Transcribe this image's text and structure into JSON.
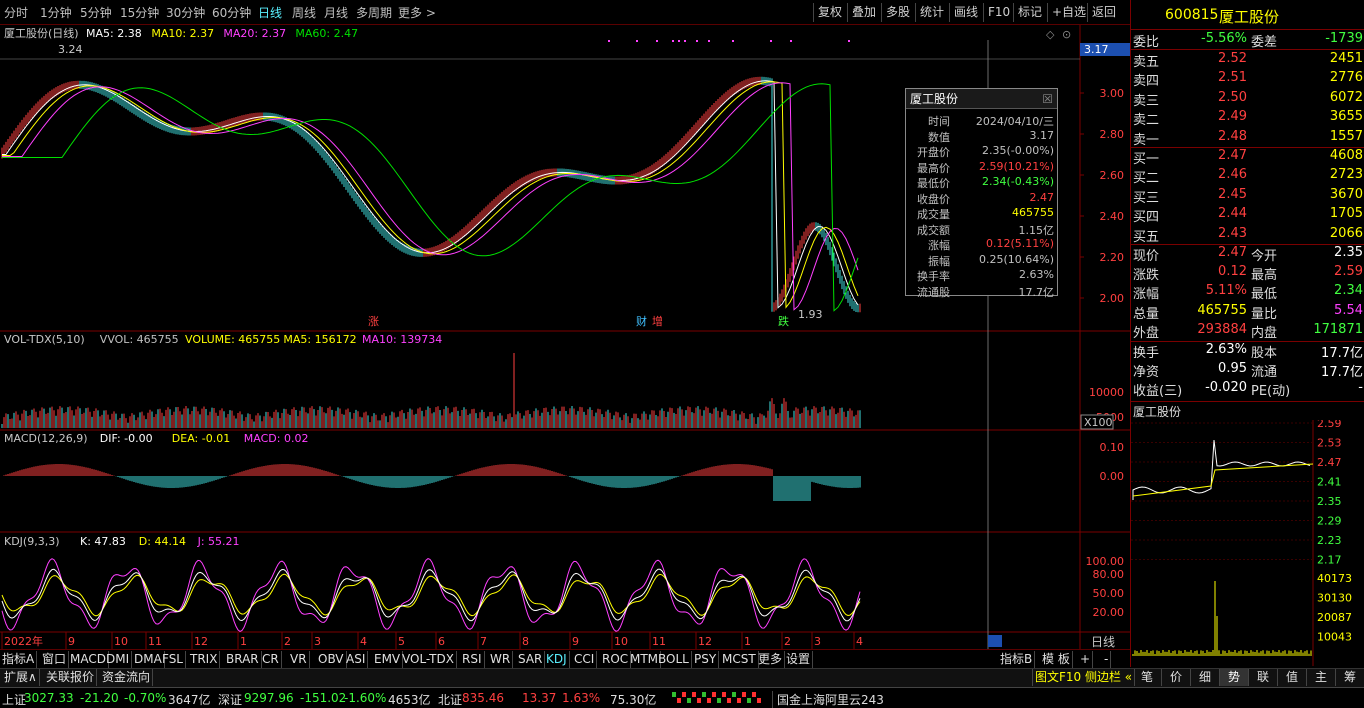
{
  "toolbar": {
    "periods": [
      "分时",
      "1分钟",
      "5分钟",
      "15分钟",
      "30分钟",
      "60分钟",
      "日线",
      "周线",
      "月线",
      "多周期",
      "更多 >"
    ],
    "active": "日线",
    "right": [
      "复权",
      "叠加",
      "多股",
      "统计",
      "画线",
      "F10",
      "标记",
      "+自选",
      "返回"
    ]
  },
  "chart": {
    "title": "厦工股份(日线)",
    "ma": [
      {
        "label": "MA5: 2.38",
        "color": "#ffffff"
      },
      {
        "label": "MA10: 2.37",
        "color": "#ffff00"
      },
      {
        "label": "MA20: 2.37",
        "color": "#ff40ff"
      },
      {
        "label": "MA60: 2.47",
        "color": "#00e000"
      }
    ],
    "high_label": "3.24",
    "low_label": "1.93",
    "cur_price": "3.17",
    "price_ticks": [
      "3.00",
      "2.80",
      "2.60",
      "2.40",
      "2.20",
      "2.00"
    ],
    "markers": [
      {
        "text": "涨",
        "color": "#ff4040"
      },
      {
        "text": "财",
        "color": "#40c0ff"
      },
      {
        "text": "增",
        "color": "#ff4040"
      },
      {
        "text": "跌",
        "color": "#40ff40"
      }
    ]
  },
  "vol": {
    "title": "VOL-TDX(5,10)",
    "items": [
      {
        "label": "VVOL: 465755",
        "color": "#c0c0c0"
      },
      {
        "label": "VOLUME: 465755",
        "color": "#ffff00"
      },
      {
        "label": "MA5: 156172",
        "color": "#ffff00"
      },
      {
        "label": "MA10: 139734",
        "color": "#ff40ff"
      }
    ],
    "ticks": [
      "10000",
      "5000"
    ],
    "unit": "X100"
  },
  "macd": {
    "title": "MACD(12,26,9)",
    "items": [
      {
        "label": "DIF: -0.00",
        "color": "#ffffff"
      },
      {
        "label": "DEA: -0.01",
        "color": "#ffff00"
      },
      {
        "label": "MACD: 0.02",
        "color": "#ff40ff"
      }
    ],
    "ticks": [
      "0.10",
      "0.00"
    ]
  },
  "kdj": {
    "title": "KDJ(9,3,3)",
    "items": [
      {
        "label": "K: 47.83",
        "color": "#ffffff"
      },
      {
        "label": "D: 44.14",
        "color": "#ffff00"
      },
      {
        "label": "J: 55.21",
        "color": "#ff40ff"
      }
    ],
    "ticks": [
      "100.00",
      "80.00",
      "50.00",
      "20.00"
    ]
  },
  "xaxis": {
    "labels": [
      "2022年",
      "9",
      "10",
      "11",
      "12",
      "1",
      "2",
      "3",
      "4",
      "5",
      "6",
      "7",
      "8",
      "9",
      "10",
      "11",
      "12",
      "1",
      "2",
      "3",
      "4"
    ],
    "period_label": "日线"
  },
  "tooltip": {
    "title": "厦工股份",
    "rows": [
      {
        "k": "时间",
        "v": "2024/04/10/三",
        "c": "#c0c0c0"
      },
      {
        "k": "数值",
        "v": "3.17",
        "c": "#c0c0c0"
      },
      {
        "k": "开盘价",
        "v": "2.35(-0.00%)",
        "c": "#c0c0c0"
      },
      {
        "k": "最高价",
        "v": "2.59(10.21%)",
        "c": "#ff4040"
      },
      {
        "k": "最低价",
        "v": "2.34(-0.43%)",
        "c": "#40ff40"
      },
      {
        "k": "收盘价",
        "v": "2.47",
        "c": "#ff4040"
      },
      {
        "k": "成交量",
        "v": "465755",
        "c": "#ffff00"
      },
      {
        "k": "成交额",
        "v": "1.15亿",
        "c": "#c0c0c0"
      },
      {
        "k": "涨幅",
        "v": "0.12(5.11%)",
        "c": "#ff4040"
      },
      {
        "k": "振幅",
        "v": "0.25(10.64%)",
        "c": "#c0c0c0"
      },
      {
        "k": "换手率",
        "v": "2.63%",
        "c": "#c0c0c0"
      },
      {
        "k": "流通股",
        "v": "17.7亿",
        "c": "#c0c0c0"
      }
    ]
  },
  "quote": {
    "code": "600815",
    "name": "厦工股份",
    "webi": {
      "k": "委比",
      "v": "-5.56%",
      "k2": "委差",
      "v2": "-1739"
    },
    "sell": [
      {
        "k": "卖五",
        "p": "2.52",
        "v": "2451"
      },
      {
        "k": "卖四",
        "p": "2.51",
        "v": "2776"
      },
      {
        "k": "卖三",
        "p": "2.50",
        "v": "6072"
      },
      {
        "k": "卖二",
        "p": "2.49",
        "v": "3655"
      },
      {
        "k": "卖一",
        "p": "2.48",
        "v": "1557"
      }
    ],
    "buy": [
      {
        "k": "买一",
        "p": "2.47",
        "v": "4608"
      },
      {
        "k": "买二",
        "p": "2.46",
        "v": "2723"
      },
      {
        "k": "买三",
        "p": "2.45",
        "v": "3670"
      },
      {
        "k": "买四",
        "p": "2.44",
        "v": "1705"
      },
      {
        "k": "买五",
        "p": "2.43",
        "v": "2066"
      }
    ],
    "stats": [
      {
        "k": "现价",
        "v": "2.47",
        "c": "#ff4040",
        "k2": "今开",
        "v2": "2.35",
        "c2": "#ffffff"
      },
      {
        "k": "涨跌",
        "v": "0.12",
        "c": "#ff4040",
        "k2": "最高",
        "v2": "2.59",
        "c2": "#ff4040"
      },
      {
        "k": "涨幅",
        "v": "5.11%",
        "c": "#ff4040",
        "k2": "最低",
        "v2": "2.34",
        "c2": "#40ff40"
      },
      {
        "k": "总量",
        "v": "465755",
        "c": "#ffff00",
        "k2": "量比",
        "v2": "5.54",
        "c2": "#ff40ff"
      },
      {
        "k": "外盘",
        "v": "293884",
        "c": "#ff4040",
        "k2": "内盘",
        "v2": "171871",
        "c2": "#40ff40"
      }
    ],
    "stats2": [
      {
        "k": "换手",
        "v": "2.63%",
        "k2": "股本",
        "v2": "17.7亿"
      },
      {
        "k": "净资",
        "v": "0.95",
        "k2": "流通",
        "v2": "17.7亿"
      },
      {
        "k": "收益(三)",
        "v": "-0.020",
        "k2": "PE(动)",
        "v2": "-"
      }
    ]
  },
  "mini": {
    "title": "厦工股份",
    "ticks": [
      {
        "v": "2.59",
        "c": "#ff4040"
      },
      {
        "v": "2.53",
        "c": "#ff4040"
      },
      {
        "v": "2.47",
        "c": "#ff4040"
      },
      {
        "v": "2.41",
        "c": "#40ff40"
      },
      {
        "v": "2.35",
        "c": "#40ff40"
      },
      {
        "v": "2.29",
        "c": "#40ff40"
      },
      {
        "v": "2.23",
        "c": "#40ff40"
      },
      {
        "v": "2.17",
        "c": "#40ff40"
      }
    ],
    "vticks": [
      "40173",
      "30130",
      "20087",
      "10043"
    ],
    "tabs": [
      "笔",
      "价",
      "细",
      "势",
      "联",
      "值",
      "主",
      "筹"
    ],
    "active_tab": "势"
  },
  "indicators": [
    "指标A",
    "窗口",
    "MACD",
    "DMI",
    "DMA",
    "FSL",
    "TRIX",
    "BRAR",
    "CR",
    "VR",
    "OBV",
    "ASI",
    "EMV",
    "VOL-TDX",
    "RSI",
    "WR",
    "SAR",
    "KDJ",
    "CCI",
    "ROC",
    "MTM",
    "BOLL",
    "PSY",
    "MCST",
    "更多",
    "设置"
  ],
  "ind_right": [
    "指标B",
    "模 板",
    "+",
    "-"
  ],
  "bottom_tabs": [
    "扩展∧",
    "关联报价",
    "资金流向"
  ],
  "sidebar_btn": "图文F10 侧边栏 «",
  "status": [
    {
      "name": "上证",
      "v": "3027.33",
      "ch": "-21.20",
      "pc": "-0.70%",
      "amt": "3647亿",
      "c": "#40ff40"
    },
    {
      "name": "深证",
      "v": "9297.96",
      "ch": "-151.02",
      "pc": "-1.60%",
      "amt": "4653亿",
      "c": "#40ff40"
    },
    {
      "name": "北证",
      "v": "835.46",
      "ch": "13.37",
      "pc": "1.63%",
      "amt": "75.30亿",
      "c": "#ff4040"
    }
  ],
  "server": "国金上海阿里云243"
}
